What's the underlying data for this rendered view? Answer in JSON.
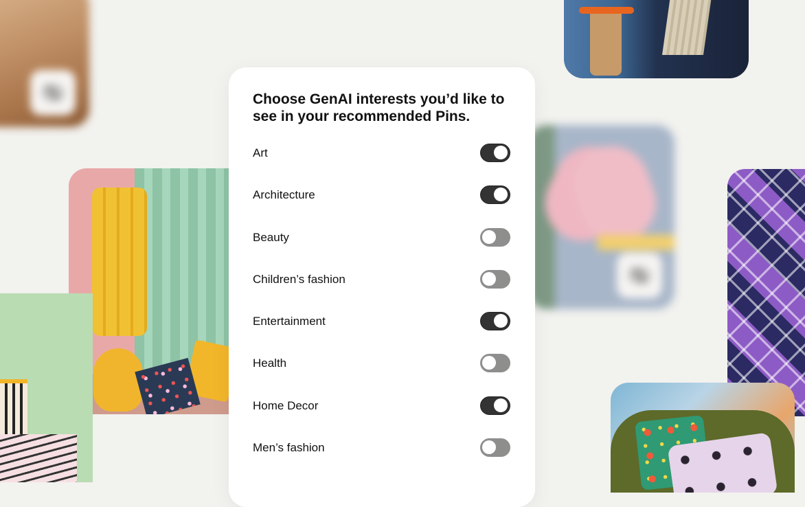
{
  "prompt_title": "Choose GenAI interests you’d like to see in your recommended Pins.",
  "interests": [
    {
      "label": "Art",
      "enabled": true
    },
    {
      "label": "Architecture",
      "enabled": true
    },
    {
      "label": "Beauty",
      "enabled": false
    },
    {
      "label": "Children’s fashion",
      "enabled": false
    },
    {
      "label": "Entertainment",
      "enabled": true
    },
    {
      "label": "Health",
      "enabled": false
    },
    {
      "label": "Home Decor",
      "enabled": true
    },
    {
      "label": "Men’s fashion",
      "enabled": false
    }
  ],
  "colors": {
    "background": "#f2f2ef",
    "toggle_on": "#333333",
    "toggle_off": "#8e8e8c"
  },
  "icons": {
    "hide_badge": "eye-slash-icon"
  }
}
